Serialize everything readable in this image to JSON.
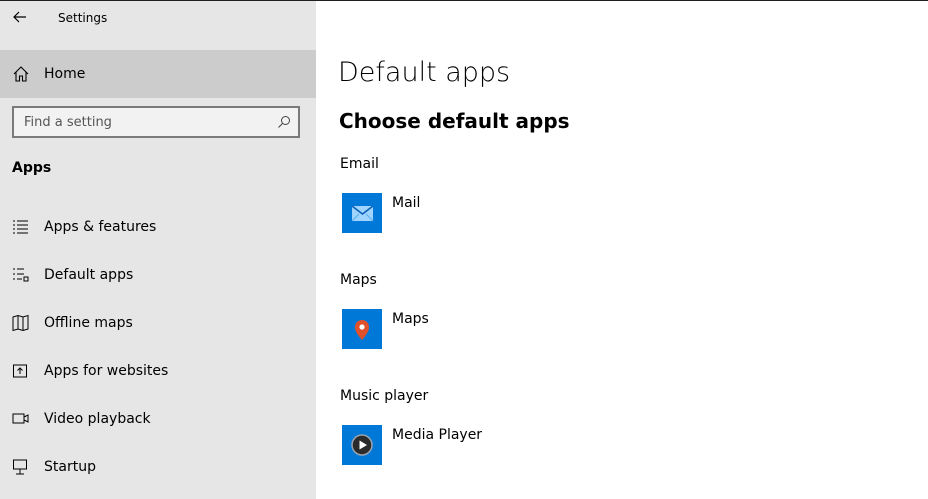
{
  "window": {
    "title": "Settings"
  },
  "sidebar": {
    "home_label": "Home",
    "search_placeholder": "Find a setting",
    "section_title": "Apps",
    "items": [
      {
        "label": "Apps & features",
        "icon": "list-icon"
      },
      {
        "label": "Default apps",
        "icon": "default-apps-icon"
      },
      {
        "label": "Offline maps",
        "icon": "map-icon"
      },
      {
        "label": "Apps for websites",
        "icon": "open-link-icon"
      },
      {
        "label": "Video playback",
        "icon": "video-icon"
      },
      {
        "label": "Startup",
        "icon": "startup-icon"
      }
    ]
  },
  "main": {
    "page_title": "Default apps",
    "subtitle": "Choose default apps",
    "categories": [
      {
        "label": "Email",
        "app": "Mail",
        "icon": "mail-icon"
      },
      {
        "label": "Maps",
        "app": "Maps",
        "icon": "map-pin-icon"
      },
      {
        "label": "Music player",
        "app": "Media Player",
        "icon": "play-icon"
      }
    ]
  },
  "colors": {
    "sidebar_bg": "#e6e6e6",
    "selected_bg": "#cccccc",
    "tile_blue": "#0078d7",
    "map_pin": "#e0502a"
  }
}
